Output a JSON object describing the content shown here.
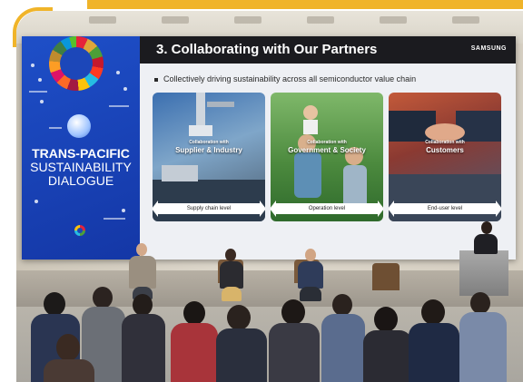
{
  "screen": {
    "left_panel": {
      "title": "TRANS-PACIFIC",
      "subtitle_line1": "SUSTAINABILITY",
      "subtitle_line2": "DIALOGUE"
    },
    "slide": {
      "title": "3. Collaborating with Our Partners",
      "brand": "SAMSUNG",
      "bullet": "Collectively driving sustainability across all semiconductor value chain",
      "cards": [
        {
          "small": "Collaboration with",
          "big": "Supplier & Industry",
          "level": "Supply chain level"
        },
        {
          "small": "Collaboration with",
          "big": "Government & Society",
          "level": "Operation level"
        },
        {
          "small": "Collaboration with",
          "big": "Customers",
          "level": "End-user level"
        }
      ]
    }
  },
  "colors": {
    "accent": "#f0b429",
    "panel_blue": "#1e4fc8",
    "header_black": "#1b1b1f"
  }
}
